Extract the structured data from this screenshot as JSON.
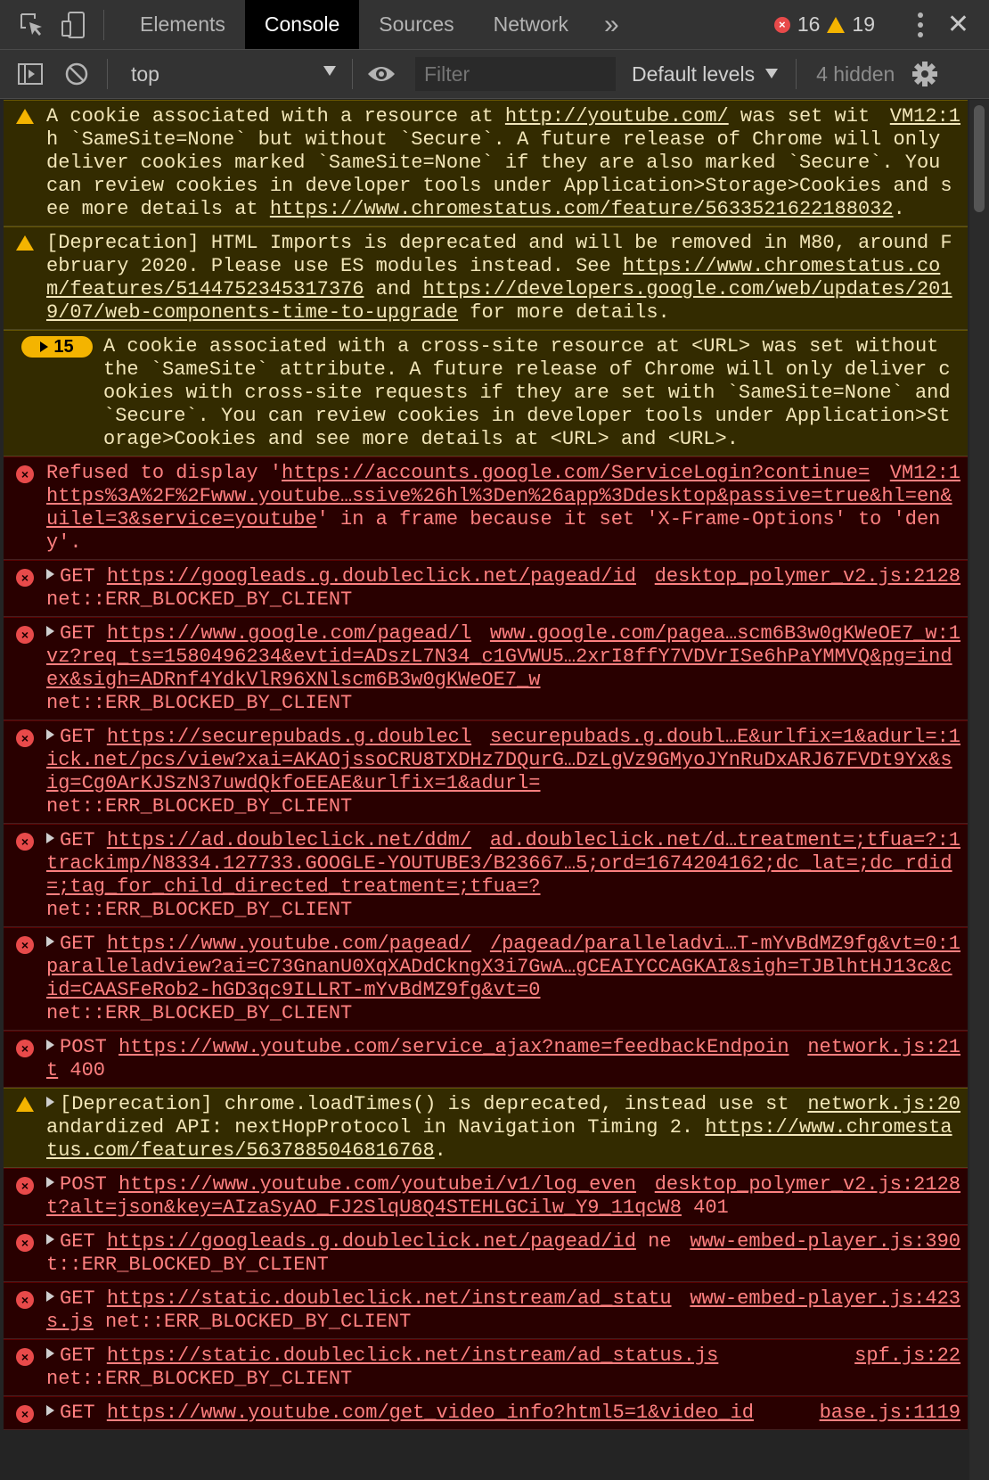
{
  "tabs": {
    "items": [
      "Elements",
      "Console",
      "Sources",
      "Network"
    ],
    "active_index": 1,
    "more": "»"
  },
  "counts": {
    "errors": "16",
    "warnings": "19"
  },
  "toolbar": {
    "context": "top",
    "filter_placeholder": "Filter",
    "levels": "Default levels",
    "hidden": "4 hidden"
  },
  "colors": {
    "warn_bg": "#332b00",
    "error_bg": "#290000",
    "warn_text": "#f2e6b8",
    "error_text": "#ff8080"
  },
  "messages": [
    {
      "level": "warn",
      "source": "VM12:1",
      "parts": [
        {
          "t": "A cookie associated with a resource at "
        },
        {
          "t": "http://youtube.com/",
          "link": true
        },
        {
          "t": " was set with `SameSite=None` but without `Secure`. A future release of Chrome will only deliver cookies marked `SameSite=None` if they are also marked `Secure`. You can review cookies in developer tools under Application>Storage>Cookies and see more details at "
        },
        {
          "t": "https://www.chromestatus.com/feature/5633521622188032",
          "link": true
        },
        {
          "t": "."
        }
      ]
    },
    {
      "level": "warn",
      "parts": [
        {
          "t": "[Deprecation] HTML Imports is deprecated and will be removed in M80, around February 2020. Please use ES modules instead. See "
        },
        {
          "t": "https://www.chromestatus.com/features/5144752345317376",
          "link": true
        },
        {
          "t": " and "
        },
        {
          "t": "https://developers.google.com/web/updates/2019/07/web-components-time-to-upgrade",
          "link": true
        },
        {
          "t": " for more details."
        }
      ]
    },
    {
      "level": "warn",
      "badge": "15",
      "parts": [
        {
          "t": "A cookie associated with a cross-site resource at <URL> was set without the `SameSite` attribute. A future release of Chrome will only deliver cookies with cross-site requests if they are set with `SameSite=None` and `Secure`. You can review cookies in developer tools under Application>Storage>Cookies and see more details at <URL> and <URL>."
        }
      ]
    },
    {
      "level": "error",
      "source": "VM12:1",
      "parts": [
        {
          "t": "Refused to display '"
        },
        {
          "t": "https://accounts.google.com/ServiceLogin?continue=https%3A%2F%2Fwww.youtube…ssive%26hl%3Den%26app%3Ddesktop&passive=true&hl=en&uilel=3&service=youtube",
          "link": true
        },
        {
          "t": "' in a frame because it set 'X-Frame-Options' to 'deny'."
        }
      ]
    },
    {
      "level": "error",
      "expand": true,
      "source": "desktop_polymer_v2.js:2128",
      "parts": [
        {
          "t": "GET "
        },
        {
          "t": "https://googleads.g.doubleclick.net/pagead/id",
          "link": true
        },
        {
          "t": " net::ERR_BLOCKED_BY_CLIENT"
        }
      ]
    },
    {
      "level": "error",
      "expand": true,
      "source": "www.google.com/pagea…scm6B3w0gKWeOE7_w:1",
      "parts": [
        {
          "t": "GET "
        },
        {
          "t": "https://www.google.com/pagead/lvz?req_ts=1580496234&evtid=ADszL7N34_c1GVWU5…2xrI8ffY7VDVrISe6hPaYMMVQ&pg=index&sigh=ADRnf4YdkVlR96XNlscm6B3w0gKWeOE7_w",
          "link": true
        },
        {
          "t": "\nnet::ERR_BLOCKED_BY_CLIENT"
        }
      ]
    },
    {
      "level": "error",
      "expand": true,
      "source": "securepubads.g.doubl…E&urlfix=1&adurl=:1",
      "parts": [
        {
          "t": "GET "
        },
        {
          "t": "https://securepubads.g.doubleclick.net/pcs/view?xai=AKAOjssoCRU8TXDHz7DQurG…DzLgVz9GMyoJYnRuDxARJ67FVDt9Yx&sig=Cg0ArKJSzN37uwdQkfoEEAE&urlfix=1&adurl=",
          "link": true
        },
        {
          "t": "\nnet::ERR_BLOCKED_BY_CLIENT"
        }
      ]
    },
    {
      "level": "error",
      "expand": true,
      "source": "ad.doubleclick.net/d…treatment=;tfua=?:1",
      "parts": [
        {
          "t": "GET "
        },
        {
          "t": "https://ad.doubleclick.net/ddm/trackimp/N8334.127733.GOOGLE-YOUTUBE3/B23667…5;ord=1674204162;dc_lat=;dc_rdid=;tag_for_child_directed_treatment=;tfua=?",
          "link": true
        },
        {
          "t": "\nnet::ERR_BLOCKED_BY_CLIENT"
        }
      ]
    },
    {
      "level": "error",
      "expand": true,
      "source": "/pagead/paralleladvi…T-mYvBdMZ9fg&vt=0:1",
      "parts": [
        {
          "t": "GET "
        },
        {
          "t": "https://www.youtube.com/pagead/paralleladview?ai=C73GnanU0XqXADdCkngX3i7GwA…gCEAIYCCAGKAI&sigh=TJBlhtHJ13c&cid=CAASFeRob2-hGD3qc9ILLRT-mYvBdMZ9fg&vt=0",
          "link": true
        },
        {
          "t": "\nnet::ERR_BLOCKED_BY_CLIENT"
        }
      ]
    },
    {
      "level": "error",
      "expand": true,
      "source": "network.js:21",
      "parts": [
        {
          "t": "POST "
        },
        {
          "t": "https://www.youtube.com/service_ajax?name=feedbackEndpoint",
          "link": true
        },
        {
          "t": " 400"
        }
      ]
    },
    {
      "level": "warn",
      "expand": true,
      "source": "network.js:20",
      "parts": [
        {
          "t": "[Deprecation] chrome.loadTimes() is deprecated, instead use standardized API: nextHopProtocol in Navigation Timing 2. "
        },
        {
          "t": "https://www.chromestatus.com/features/5637885046816768",
          "link": true
        },
        {
          "t": "."
        }
      ]
    },
    {
      "level": "error",
      "expand": true,
      "source": "desktop_polymer_v2.js:2128",
      "parts": [
        {
          "t": "POST "
        },
        {
          "t": "https://www.youtube.com/youtubei/v1/log_event?alt=json&key=AIzaSyAO_FJ2SlqU8Q4STEHLGCilw_Y9_11qcW8",
          "link": true
        },
        {
          "t": " 401"
        }
      ]
    },
    {
      "level": "error",
      "expand": true,
      "source": "www-embed-player.js:390",
      "parts": [
        {
          "t": "GET "
        },
        {
          "t": "https://googleads.g.doubleclick.net/pagead/id",
          "link": true
        },
        {
          "t": " net::ERR_BLOCKED_BY_CLIENT"
        }
      ]
    },
    {
      "level": "error",
      "expand": true,
      "source": "www-embed-player.js:423",
      "parts": [
        {
          "t": "GET "
        },
        {
          "t": "https://static.doubleclick.net/instream/ad_status.js",
          "link": true
        },
        {
          "t": " net::ERR_BLOCKED_BY_CLIENT"
        }
      ]
    },
    {
      "level": "error",
      "expand": true,
      "source": "spf.js:22",
      "parts": [
        {
          "t": "GET "
        },
        {
          "t": "https://static.doubleclick.net/instream/ad_status.js",
          "link": true
        },
        {
          "t": "\nnet::ERR_BLOCKED_BY_CLIENT"
        }
      ]
    },
    {
      "level": "error",
      "expand": true,
      "source": "base.js:1119",
      "parts": [
        {
          "t": "GET "
        },
        {
          "t": "https://www.youtube.com/get_video_info?html5=1&video_id",
          "link": true
        }
      ]
    }
  ]
}
